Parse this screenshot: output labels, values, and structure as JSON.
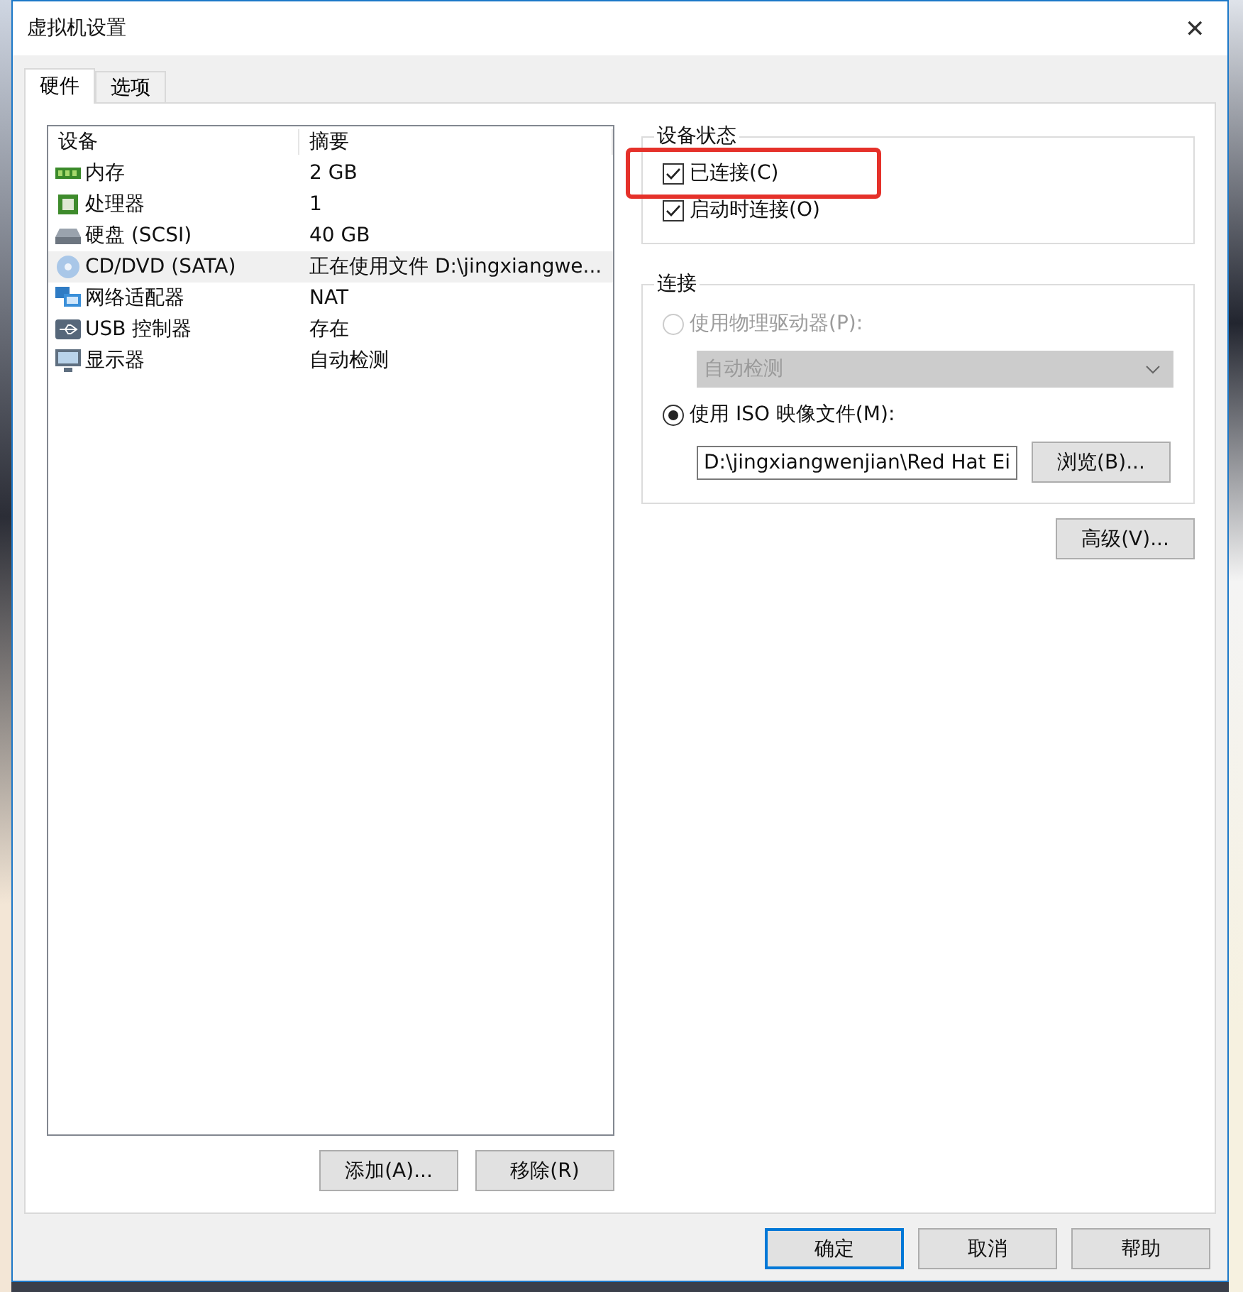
{
  "window": {
    "title": "虚拟机设置",
    "close": "✕"
  },
  "tabs": [
    {
      "label": "硬件",
      "selected": true
    },
    {
      "label": "选项",
      "selected": false
    }
  ],
  "device_list": {
    "columns": [
      "设备",
      "摘要"
    ],
    "rows": [
      {
        "kind": "memory",
        "device": "内存",
        "summary": "2 GB",
        "selected": false
      },
      {
        "kind": "cpu",
        "device": "处理器",
        "summary": "1",
        "selected": false
      },
      {
        "kind": "disk",
        "device": "硬盘 (SCSI)",
        "summary": "40 GB",
        "selected": false
      },
      {
        "kind": "cd",
        "device": "CD/DVD (SATA)",
        "summary": "正在使用文件 D:\\jingxiangwe...",
        "selected": true
      },
      {
        "kind": "network",
        "device": "网络适配器",
        "summary": "NAT",
        "selected": false
      },
      {
        "kind": "usb",
        "device": "USB 控制器",
        "summary": "存在",
        "selected": false
      },
      {
        "kind": "display",
        "device": "显示器",
        "summary": "自动检测",
        "selected": false
      }
    ]
  },
  "list_buttons": [
    "添加(A)...",
    "移除(R)"
  ],
  "device_status": {
    "title": "设备状态",
    "options": [
      {
        "label": "已连接(C)",
        "checked": true,
        "highlighted": true
      },
      {
        "label": "启动时连接(O)",
        "checked": true,
        "highlighted": false
      }
    ]
  },
  "connection": {
    "title": "连接",
    "physical": {
      "label": "使用物理驱动器(P):",
      "selected": false,
      "dropdown": "自动检测",
      "disabled": true
    },
    "iso": {
      "label": "使用 ISO 映像文件(M):",
      "selected": true,
      "path": "D:\\jingxiangwenjian\\Red Hat Ei",
      "browse": "浏览(B)..."
    }
  },
  "advanced_button": "高级(V)...",
  "footer_buttons": [
    {
      "label": "确定",
      "default": true
    },
    {
      "label": "取消",
      "default": false
    },
    {
      "label": "帮助",
      "default": false
    }
  ]
}
